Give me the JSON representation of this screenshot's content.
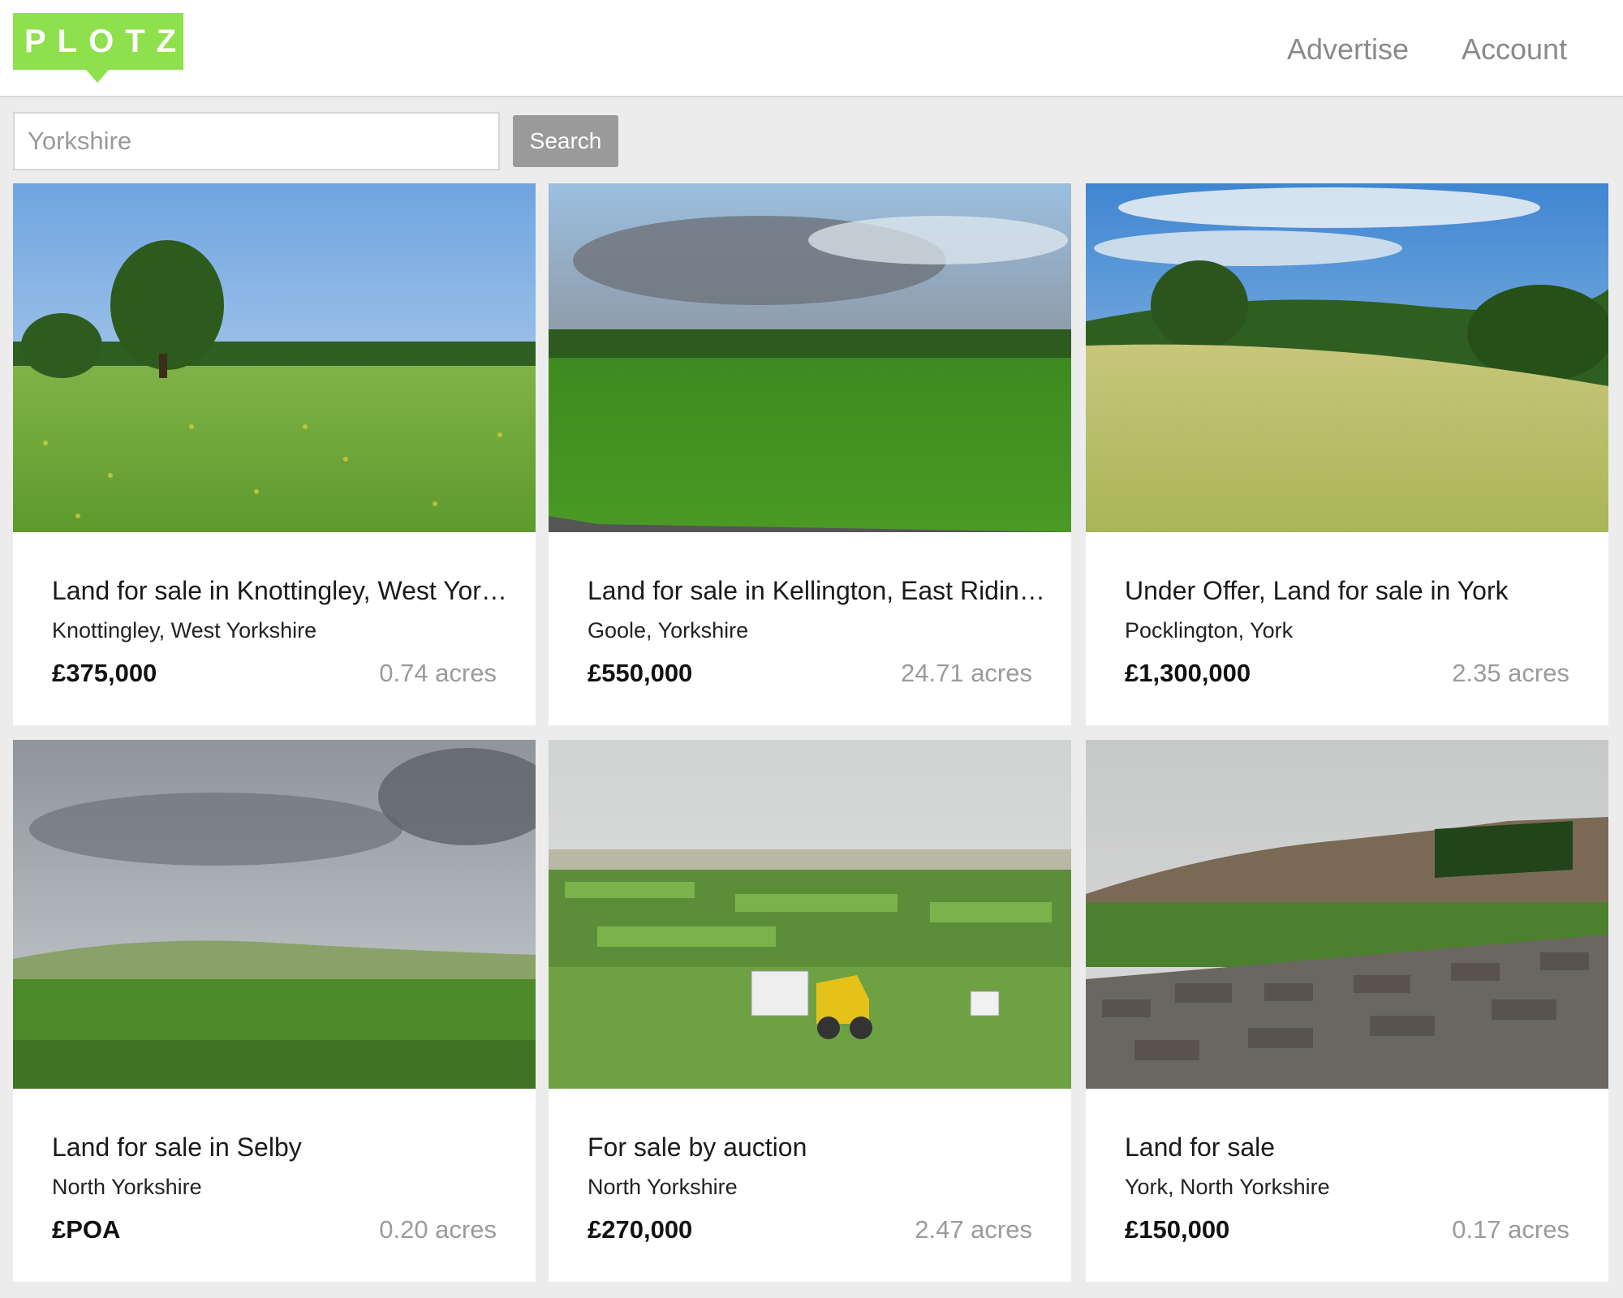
{
  "header": {
    "logo_text": "PLOTZ",
    "brand_color": "#8ee04d",
    "nav": {
      "advertise": "Advertise",
      "account": "Account"
    }
  },
  "search": {
    "value": "Yorkshire",
    "button_label": "Search"
  },
  "listings": [
    {
      "title": "Land for sale in Knottingley, West Yorkshire",
      "location": "Knottingley, West Yorkshire",
      "price": "£375,000",
      "acres": "0.74 acres",
      "image": "meadow-with-tree"
    },
    {
      "title": "Land for sale in Kellington, East Riding of Yorkshire",
      "location": "Goole, Yorkshire",
      "price": "£550,000",
      "acres": "24.71 acres",
      "image": "green-field-storm-sky"
    },
    {
      "title": "Under Offer, Land for sale in York",
      "location": "Pocklington, York",
      "price": "£1,300,000",
      "acres": "2.35 acres",
      "image": "dry-pasture-hills"
    },
    {
      "title": "Land for sale in Selby",
      "location": "North Yorkshire",
      "price": "£POA",
      "acres": "0.20 acres",
      "image": "cloudy-moorland"
    },
    {
      "title": "For sale by auction",
      "location": "North Yorkshire",
      "price": "£270,000",
      "acres": "2.47 acres",
      "image": "farmland-with-digger"
    },
    {
      "title": "Land for sale",
      "location": "York, North Yorkshire",
      "price": "£150,000",
      "acres": "0.17 acres",
      "image": "field-with-stone-wall"
    }
  ]
}
